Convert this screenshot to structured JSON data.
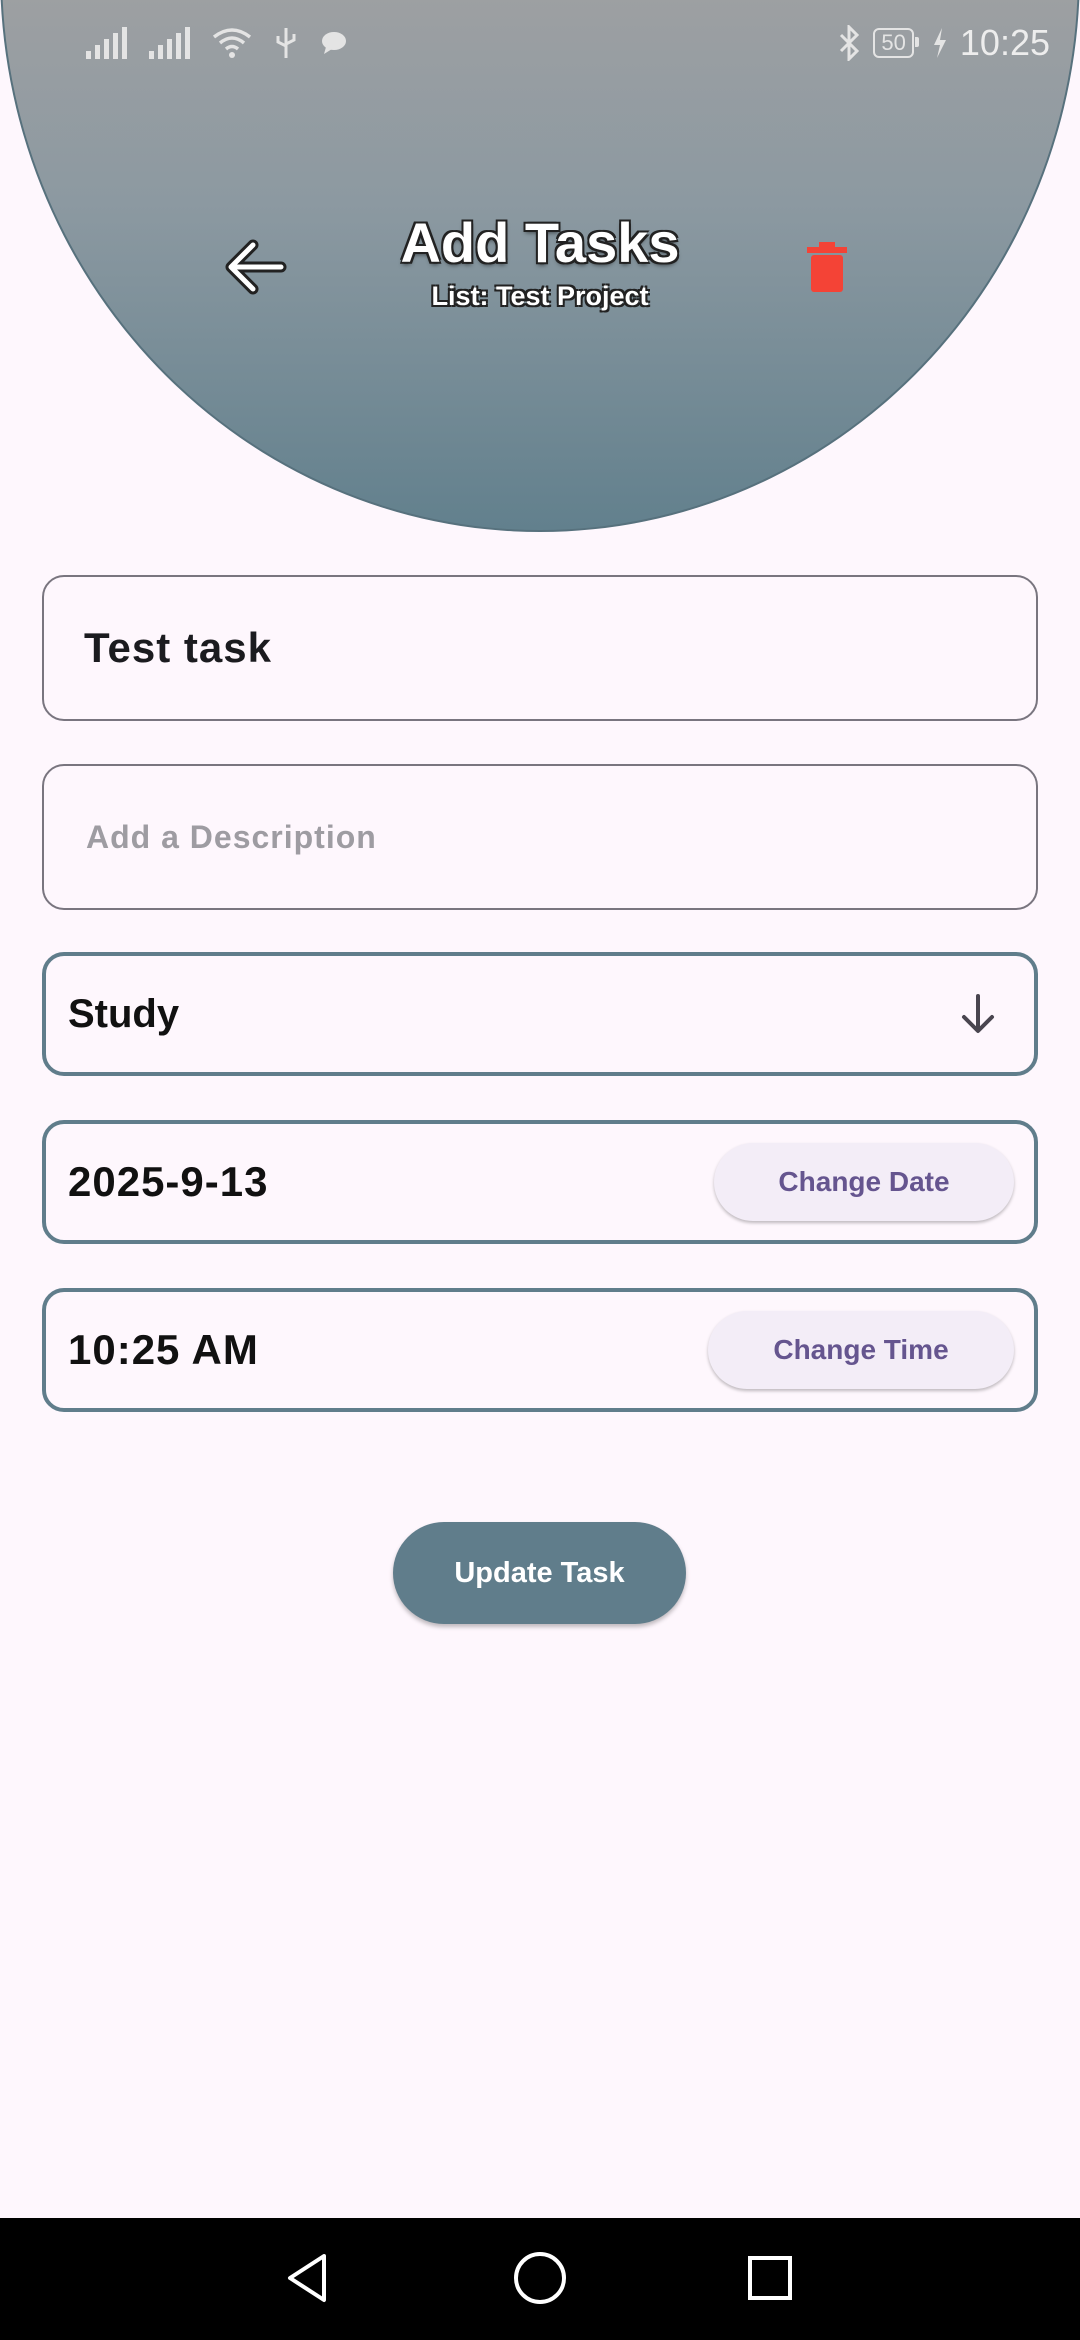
{
  "status_bar": {
    "time": "10:25",
    "battery": "50"
  },
  "header": {
    "title": "Add Tasks",
    "subtitle": "List: Test Project",
    "back_icon": "arrow-left-icon",
    "delete_icon": "trash-icon"
  },
  "form": {
    "task_name": "Test task",
    "description_placeholder": "Add a Description",
    "description_value": "",
    "category": "Study",
    "date": "2025-9-13",
    "change_date_label": "Change Date",
    "time": "10:25 AM",
    "change_time_label": "Change Time",
    "submit_label": "Update Task"
  },
  "colors": {
    "accent": "#607D8B",
    "delete": "#F44336",
    "background": "#FEF7FD",
    "button_text": "#65558F"
  },
  "nav": {
    "back_icon": "triangle-back-icon",
    "home_icon": "circle-home-icon",
    "recents_icon": "square-recents-icon"
  }
}
